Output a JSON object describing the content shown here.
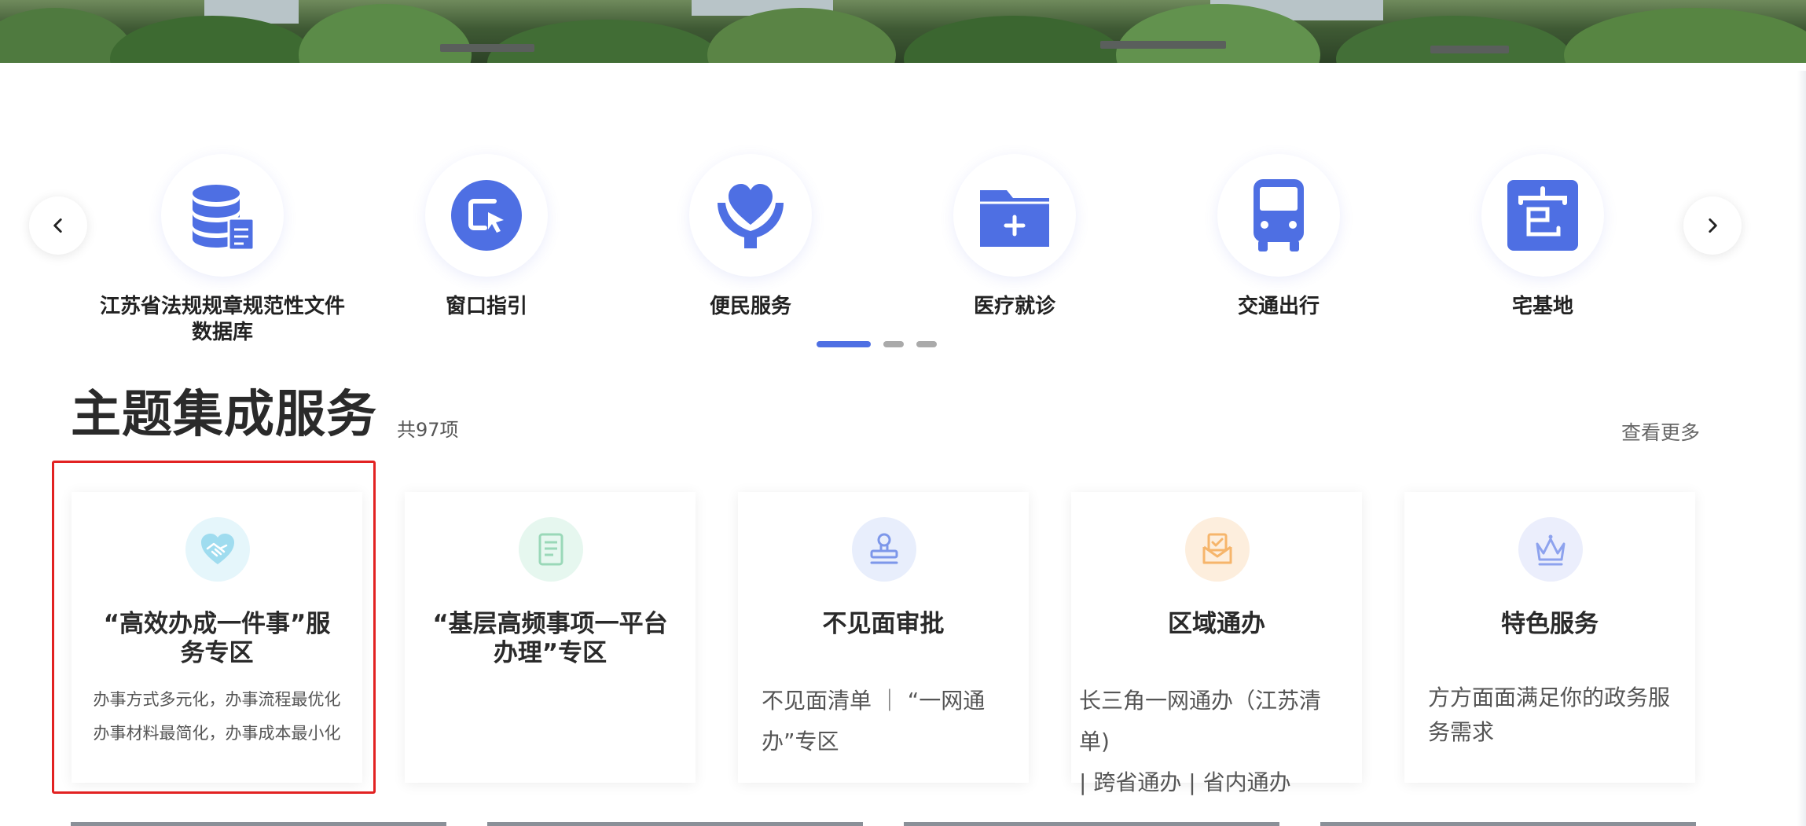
{
  "carousel": {
    "items": [
      {
        "label": "江苏省法规规章规范性文件数据库",
        "icon": "database-document-icon"
      },
      {
        "label": "窗口指引",
        "icon": "window-guide-icon"
      },
      {
        "label": "便民服务",
        "icon": "heart-hands-icon"
      },
      {
        "label": "医疗就诊",
        "icon": "medical-folder-icon"
      },
      {
        "label": "交通出行",
        "icon": "bus-icon"
      },
      {
        "label": "宅基地",
        "icon": "homestead-icon"
      }
    ],
    "page_count": 3,
    "active_page": 1
  },
  "section": {
    "title": "主题集成服务",
    "count": "共97项",
    "more": "查看更多"
  },
  "cards": [
    {
      "title": "“高效办成一件事”服务专区",
      "desc_lines": [
        "办事方式多元化，办事流程最优化",
        "办事材料最简化，办事成本最小化"
      ],
      "icon": "handshake-heart-icon"
    },
    {
      "title": "“基层高频事项一平台办理”专区",
      "desc_lines": [],
      "icon": "document-list-icon"
    },
    {
      "title": "不见面审批",
      "desc_lines": [
        "不见面清单 ｜ “一网通",
        "办”专区"
      ],
      "icon": "stamp-icon"
    },
    {
      "title": "区域通办",
      "desc_lines": [
        "长三角一网通办（江苏清单)",
        "| 跨省通办 | 省内通办"
      ],
      "icon": "check-box-icon"
    },
    {
      "title": "特色服务",
      "desc_lines": [
        "方方面面满足你的政务服",
        "务需求"
      ],
      "icon": "crown-icon"
    }
  ],
  "colors": {
    "accent": "#4e6fe3",
    "highlight": "#e22222",
    "icon_cyan_bg": "#e5f6fb",
    "icon_green_bg": "#e6f7ef",
    "icon_blue_bg": "#e8eefc",
    "icon_orange_bg": "#fdeedd",
    "icon_purple_bg": "#ebeefc"
  }
}
